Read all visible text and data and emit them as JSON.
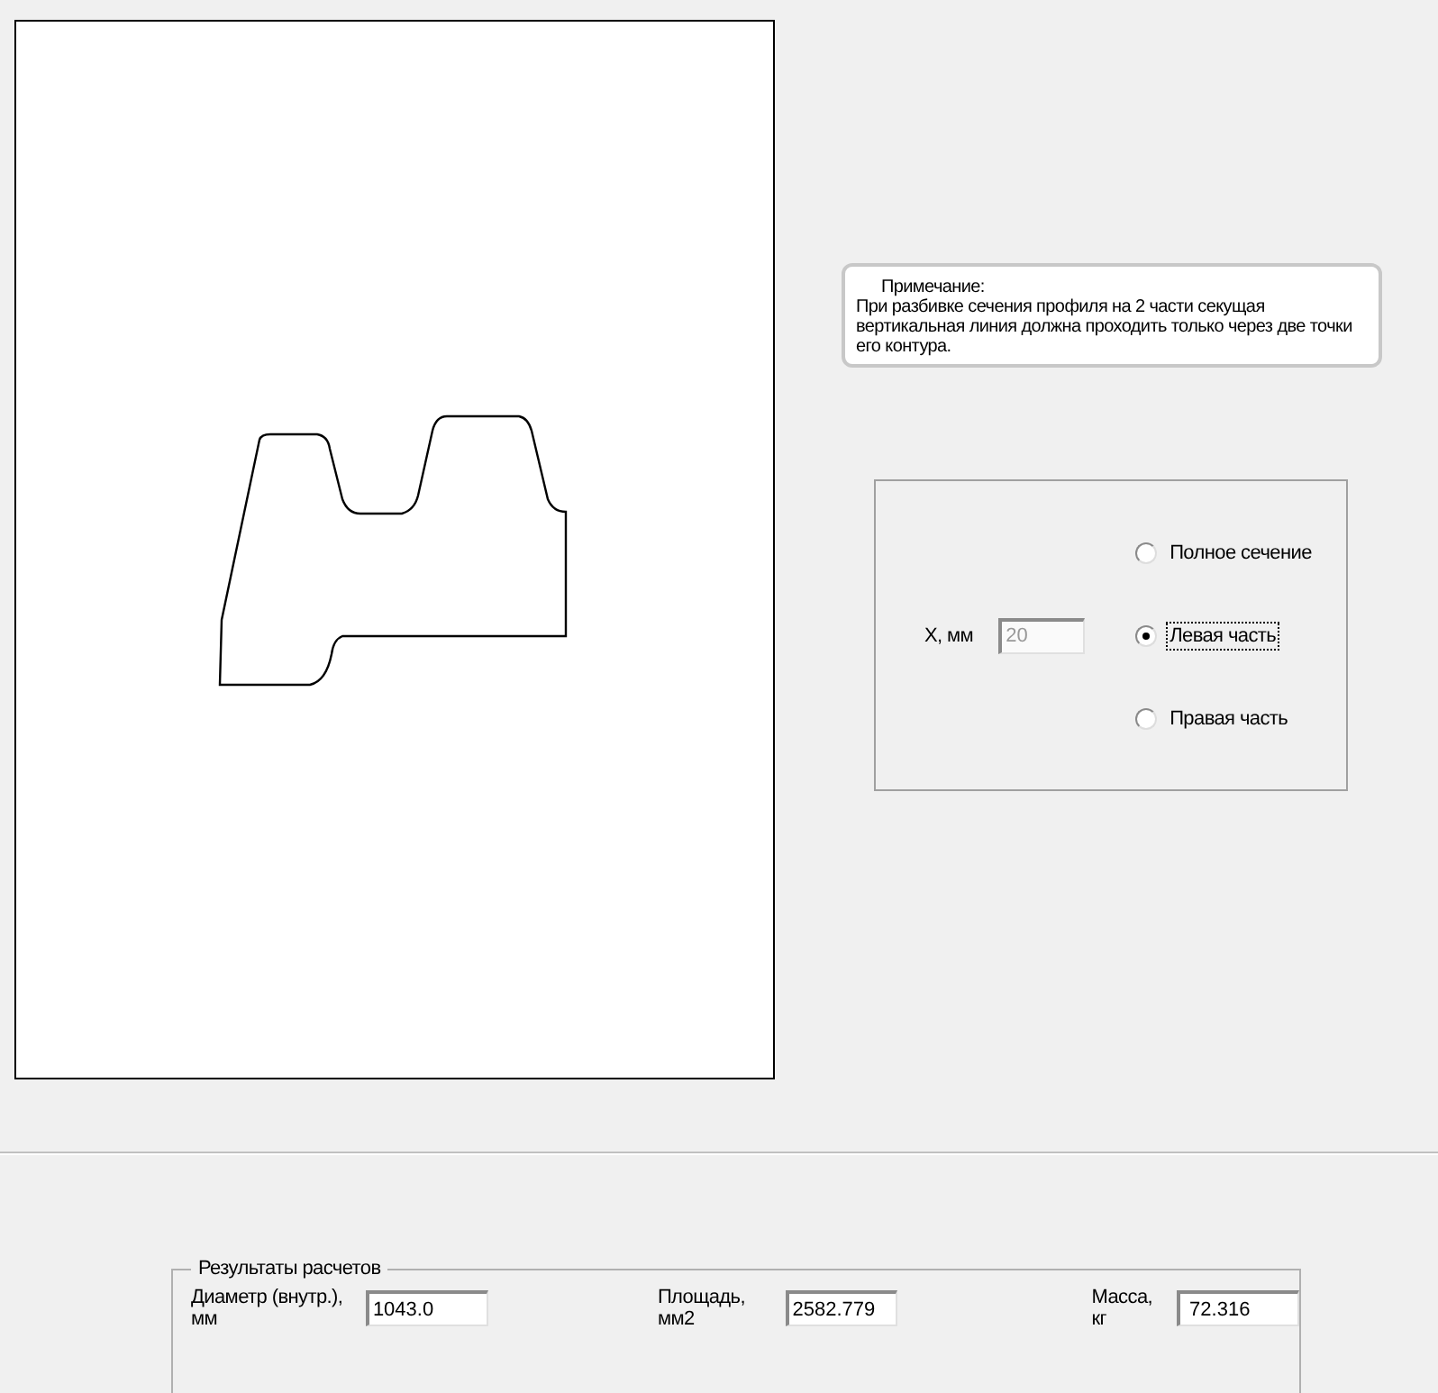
{
  "note": {
    "title": "Примечание:",
    "text": "При разбивке сечения профиля на 2 части секущая вертикальная линия должна проходить только через две точки его контура."
  },
  "section": {
    "x_label": "X, мм",
    "x_value": "20",
    "x_disabled": true,
    "options": [
      {
        "label": "Полное сечение",
        "selected": false
      },
      {
        "label": "Левая часть",
        "selected": true
      },
      {
        "label": "Правая часть",
        "selected": false
      }
    ]
  },
  "results": {
    "title": "Результаты расчетов",
    "fields": [
      {
        "label": "Диаметр (внутр.), мм",
        "value": "1043.0"
      },
      {
        "label": "Площадь, мм2",
        "value": "2582.779"
      },
      {
        "label": "Масса, кг",
        "value": " 72.316"
      }
    ]
  }
}
